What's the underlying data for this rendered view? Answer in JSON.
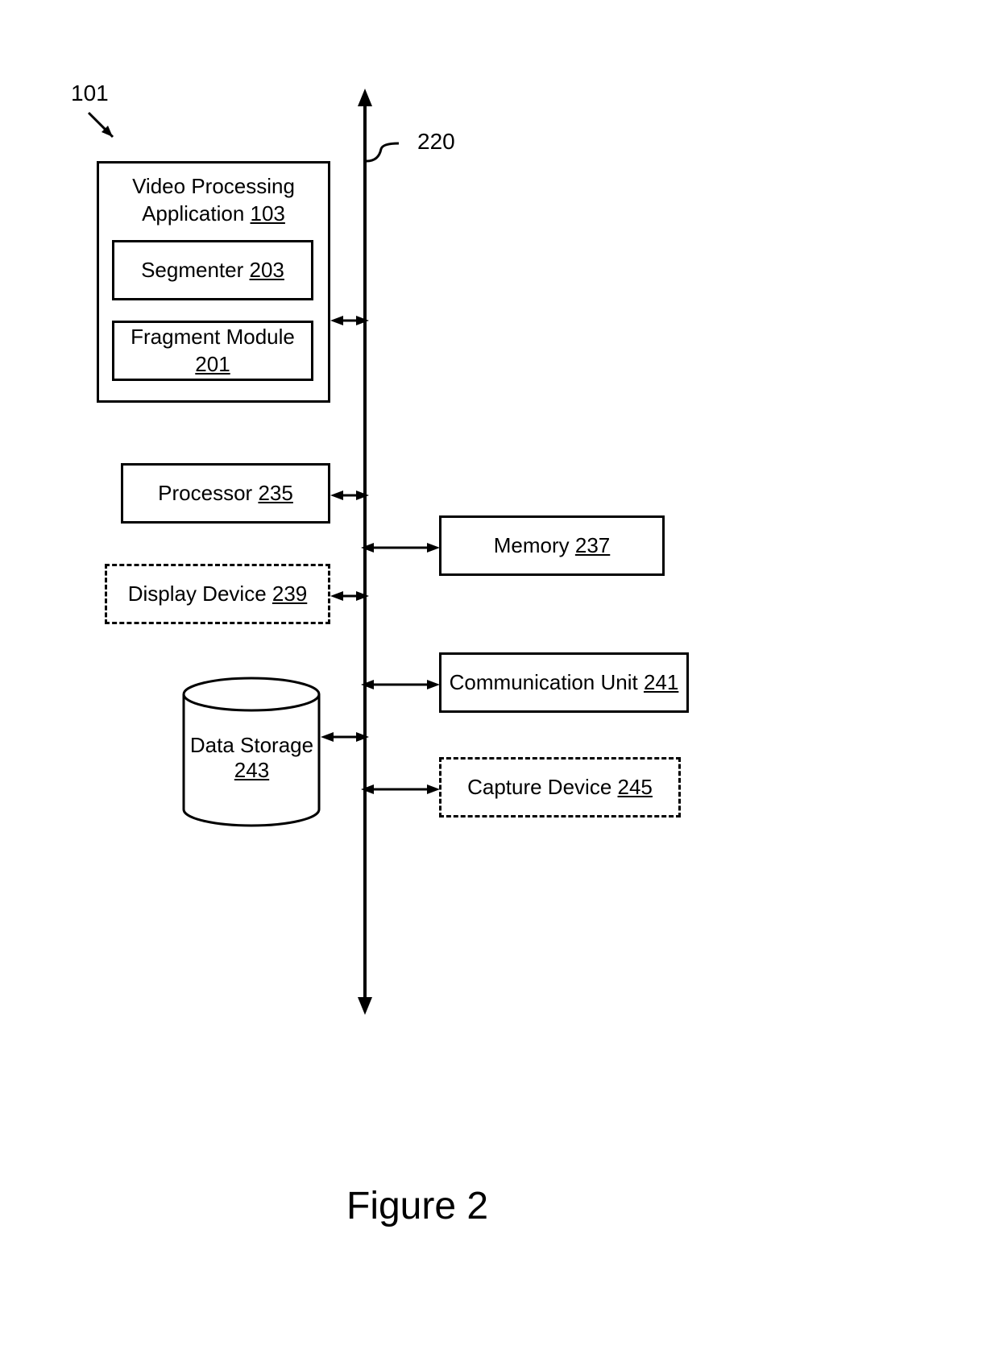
{
  "reference_101": "101",
  "reference_220": "220",
  "video_processing_app": {
    "title": "Video Processing Application",
    "ref": "103"
  },
  "segmenter": {
    "title": "Segmenter",
    "ref": "203"
  },
  "fragment_module": {
    "title": "Fragment Module",
    "ref": "201"
  },
  "processor": {
    "title": "Processor",
    "ref": "235"
  },
  "display_device": {
    "title": "Display Device",
    "ref": "239"
  },
  "data_storage": {
    "title": "Data Storage",
    "ref": "243"
  },
  "memory": {
    "title": "Memory",
    "ref": "237"
  },
  "communication_unit": {
    "title": "Communication Unit",
    "ref": "241"
  },
  "capture_device": {
    "title": "Capture Device",
    "ref": "245"
  },
  "figure_title": "Figure 2"
}
